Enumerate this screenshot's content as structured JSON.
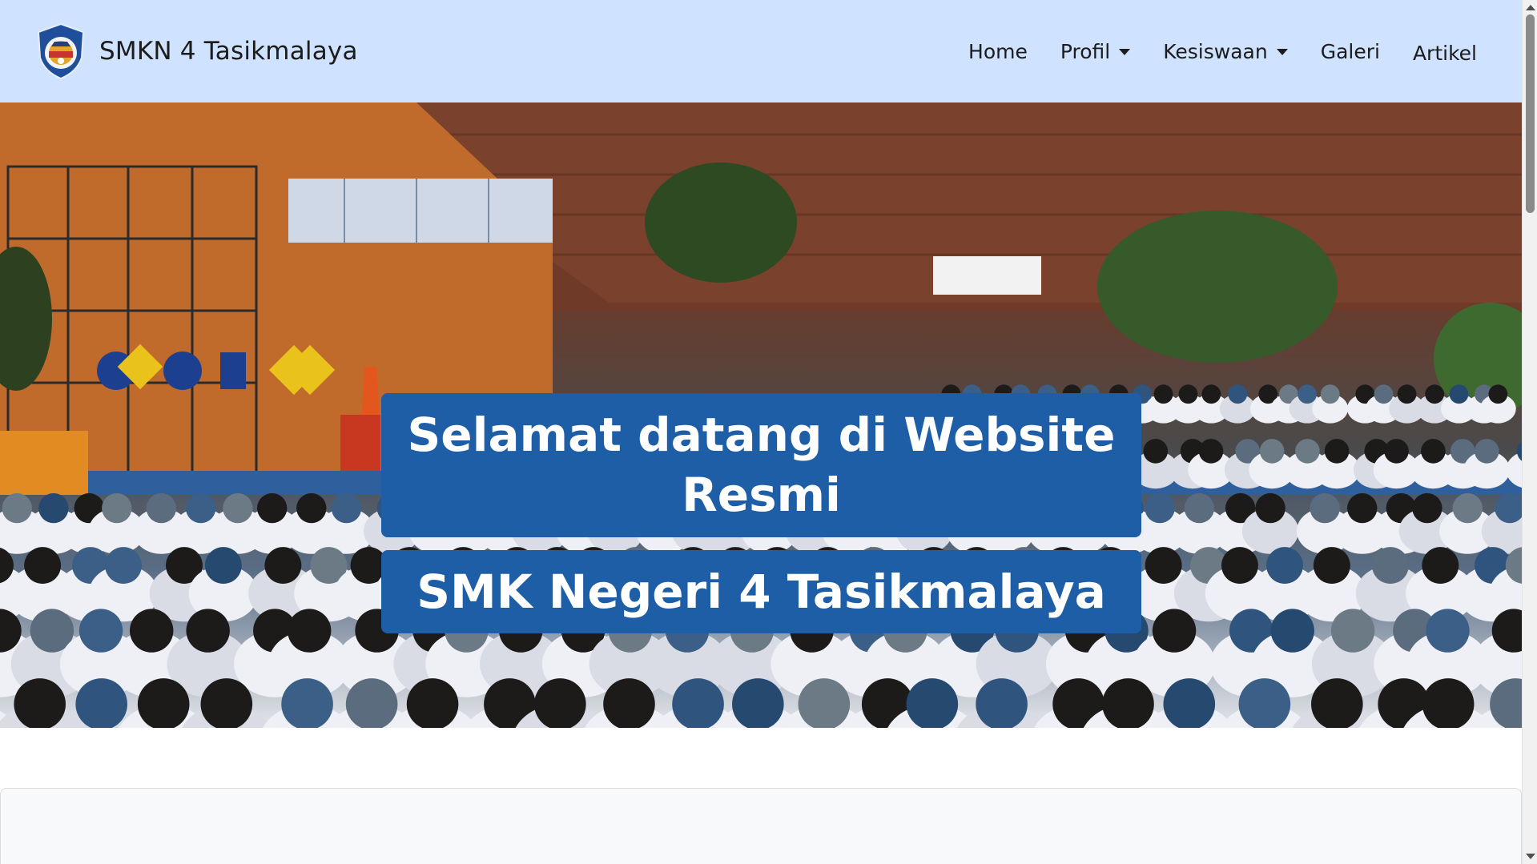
{
  "navbar": {
    "brand_name": "SMKN 4 Tasikmalaya",
    "logo_icon": "school-crest-icon",
    "items": [
      {
        "label": "Home",
        "dropdown": false
      },
      {
        "label": "Profil",
        "dropdown": true
      },
      {
        "label": "Kesiswaan",
        "dropdown": true
      },
      {
        "label": "Galeri",
        "dropdown": false
      },
      {
        "label": "Artikel",
        "dropdown": false
      }
    ],
    "background_color": "#cfe2ff"
  },
  "hero": {
    "title": "Selamat datang di Website Resmi",
    "subtitle": "SMK Negeri 4 Tasikmalaya",
    "image_description_icon": "students-assembly-photo",
    "box_color": "#1e5ea6"
  },
  "scrollbar": {
    "up_icon": "scroll-up-arrow-icon",
    "down_icon": "scroll-down-arrow-icon"
  }
}
